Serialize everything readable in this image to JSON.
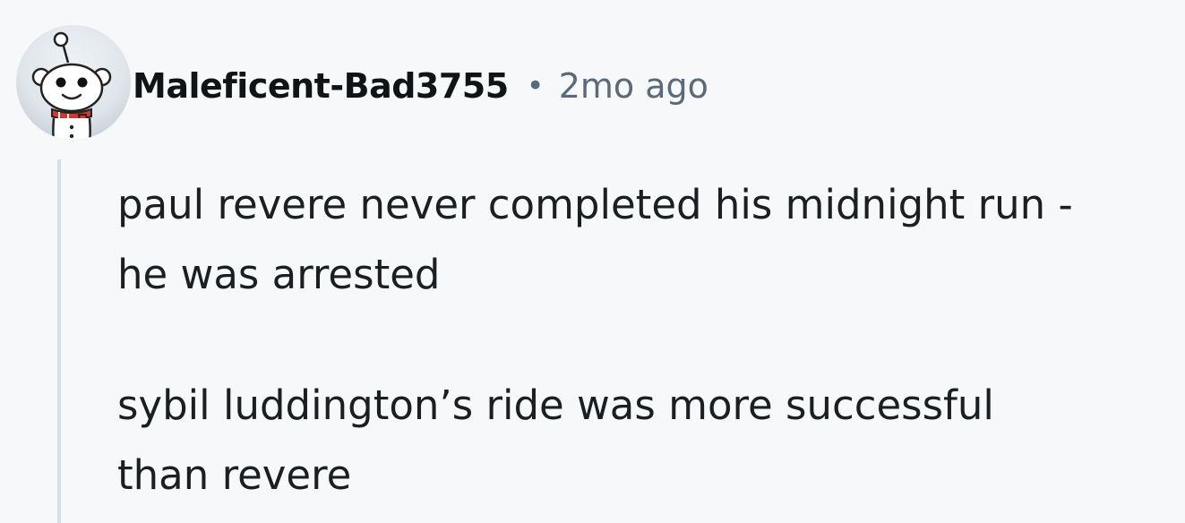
{
  "comment": {
    "author": "Maleficent-Bad3755",
    "separator": "•",
    "timestamp": "2mo ago",
    "avatar_icon": "reddit-snoo-avatar-icon",
    "paragraphs": [
      "paul revere never completed his midnight run -\nhe was arrested",
      "sybil luddington’s ride was more successful\nthan revere"
    ]
  }
}
